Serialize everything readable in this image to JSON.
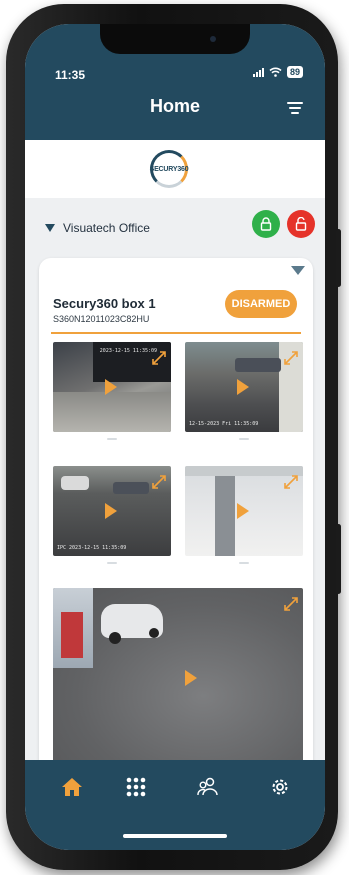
{
  "status_bar": {
    "time": "11:35",
    "battery": "89"
  },
  "header": {
    "title": "Home"
  },
  "logo": {
    "text": "SECURY360"
  },
  "site": {
    "name": "Visuatech Office"
  },
  "box": {
    "name": "Secury360 box 1",
    "serial": "S360N12011023C82HU",
    "status": "DISARMED"
  },
  "cameras": [
    {
      "id": "cam1",
      "timestamp": "2023-12-15 11:35:09"
    },
    {
      "id": "cam2",
      "timestamp": "12-15-2023 Fri 11:35:09"
    },
    {
      "id": "cam3",
      "timestamp": "IPC 2023-12-15 11:35:09"
    },
    {
      "id": "cam4",
      "timestamp": ""
    },
    {
      "id": "cam5",
      "timestamp": ""
    }
  ],
  "colors": {
    "header": "#234a5f",
    "accent": "#f0a13c",
    "lock_green": "#2fb04a",
    "lock_red": "#e5332a"
  },
  "tabs": [
    {
      "name": "home",
      "icon": "home-icon",
      "active": true
    },
    {
      "name": "grid",
      "icon": "grid-icon",
      "active": false
    },
    {
      "name": "users",
      "icon": "users-icon",
      "active": false
    },
    {
      "name": "settings",
      "icon": "gear-icon",
      "active": false
    }
  ]
}
